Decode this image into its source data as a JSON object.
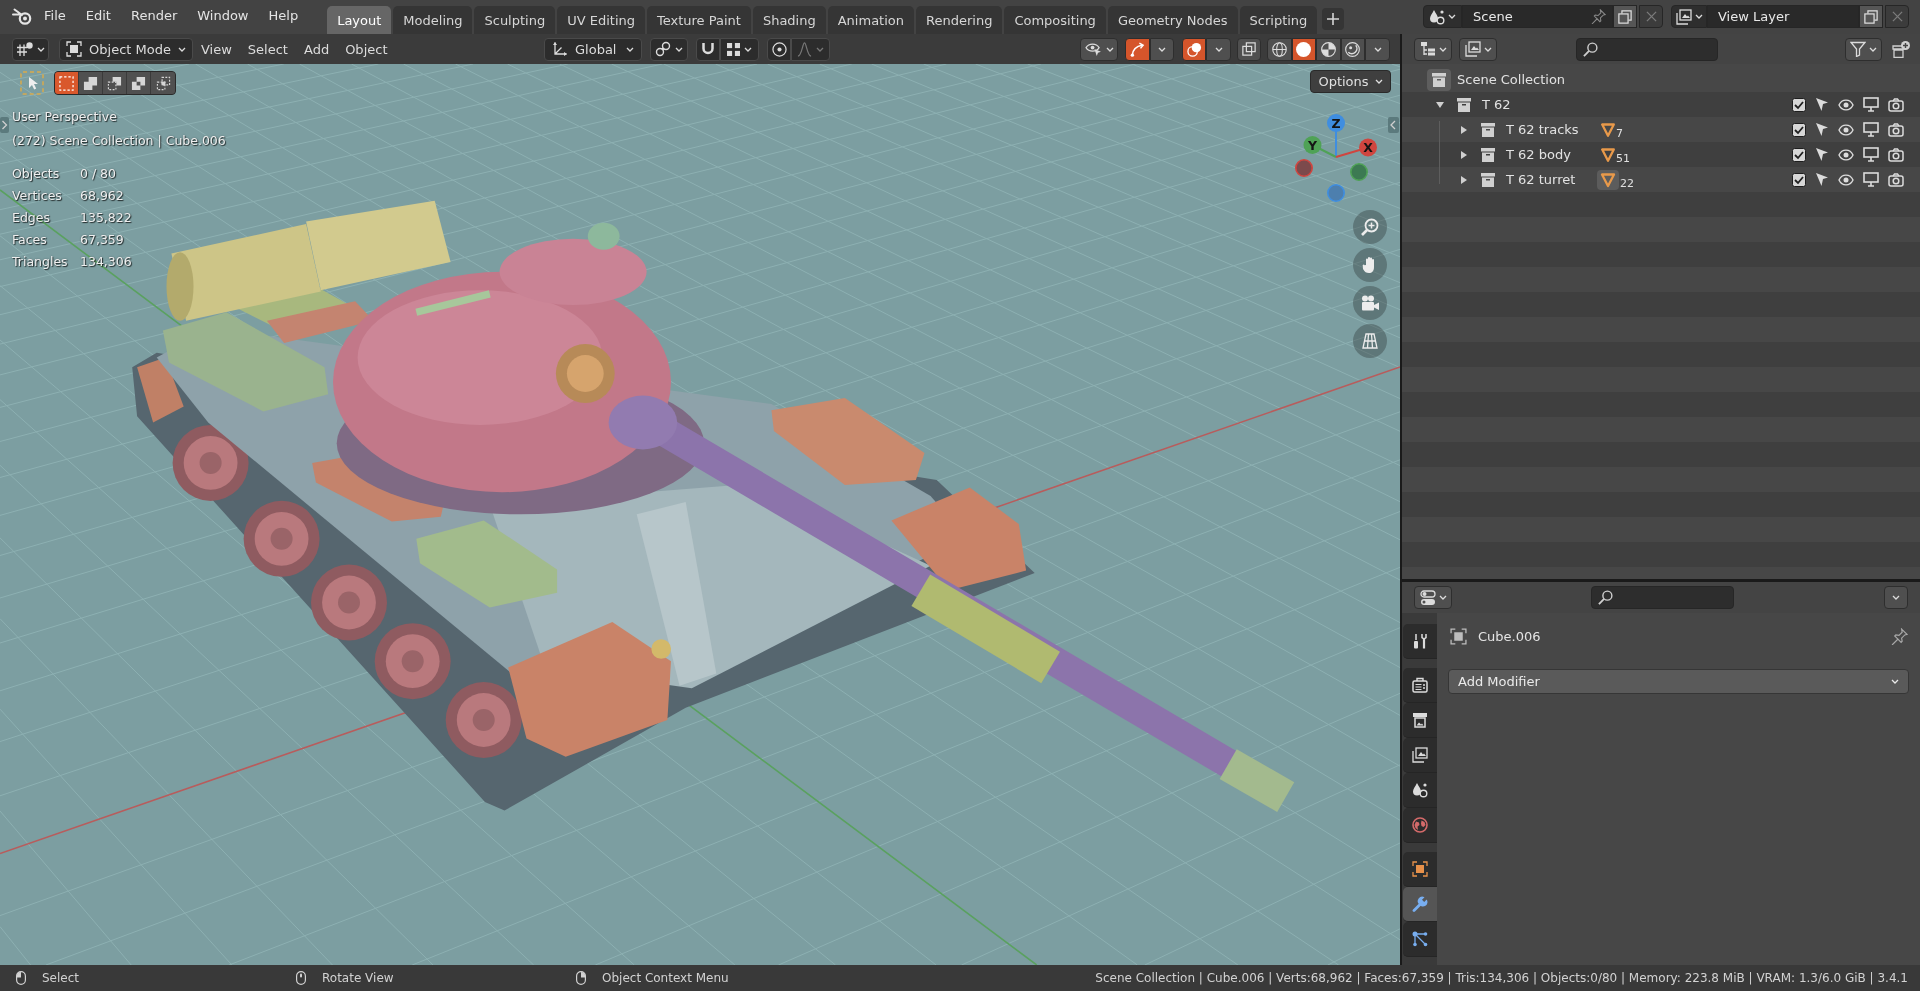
{
  "top_bar": {
    "menus": [
      "File",
      "Edit",
      "Render",
      "Window",
      "Help"
    ],
    "workspaces": [
      {
        "label": "Layout",
        "selected": true
      },
      {
        "label": "Modeling",
        "selected": false
      },
      {
        "label": "Sculpting",
        "selected": false
      },
      {
        "label": "UV Editing",
        "selected": false
      },
      {
        "label": "Texture Paint",
        "selected": false
      },
      {
        "label": "Shading",
        "selected": false
      },
      {
        "label": "Animation",
        "selected": false
      },
      {
        "label": "Rendering",
        "selected": false
      },
      {
        "label": "Compositing",
        "selected": false
      },
      {
        "label": "Geometry Nodes",
        "selected": false
      },
      {
        "label": "Scripting",
        "selected": false
      }
    ],
    "scene": "Scene",
    "view_layer": "View Layer"
  },
  "viewport": {
    "header": {
      "mode": "Object Mode",
      "menus": [
        "View",
        "Select",
        "Add",
        "Object"
      ],
      "orientation": "Global",
      "snap": false,
      "proportional_editing": false,
      "gizmos": true,
      "overlays": true,
      "xray": false,
      "shading": [
        {
          "kind": "wireframe",
          "selected": false
        },
        {
          "kind": "solid",
          "selected": true
        },
        {
          "kind": "material",
          "selected": false
        },
        {
          "kind": "rendered",
          "selected": false
        }
      ]
    },
    "select_modes": [
      {
        "kind": "set",
        "selected": true
      },
      {
        "kind": "extend",
        "selected": false
      },
      {
        "kind": "subtract",
        "selected": false
      },
      {
        "kind": "invert",
        "selected": false
      },
      {
        "kind": "intersect",
        "selected": false
      }
    ],
    "view_name": "User Perspective",
    "context": "(272) Scene Collection | Cube.006",
    "stats": [
      {
        "label": "Objects",
        "value": "0 / 80"
      },
      {
        "label": "Vertices",
        "value": "68,962"
      },
      {
        "label": "Edges",
        "value": "135,822"
      },
      {
        "label": "Faces",
        "value": "67,359"
      },
      {
        "label": "Triangles",
        "value": "134,306"
      }
    ],
    "options": "Options",
    "axes": [
      "Z",
      "Y",
      "X"
    ]
  },
  "outliner": {
    "root": "Scene Collection",
    "collections": [
      {
        "name": "T 62",
        "expanded": true,
        "checked": true,
        "children": [
          {
            "name": "T 62 tracks",
            "expanded": false,
            "checked": true,
            "count": "7",
            "active": false
          },
          {
            "name": "T 62 body",
            "expanded": false,
            "checked": true,
            "count": "51",
            "active": false
          },
          {
            "name": "T 62 turret",
            "expanded": false,
            "checked": true,
            "count": "22",
            "active": true
          }
        ]
      }
    ]
  },
  "properties": {
    "tabs": [
      {
        "kind": "tool",
        "selected": false
      },
      {
        "kind": "render",
        "selected": false
      },
      {
        "kind": "output",
        "selected": false
      },
      {
        "kind": "view_layer",
        "selected": false
      },
      {
        "kind": "scene",
        "selected": false
      },
      {
        "kind": "world",
        "selected": false
      },
      {
        "kind": "object",
        "selected": false
      },
      {
        "kind": "modifiers",
        "selected": true
      },
      {
        "kind": "particles",
        "selected": false
      }
    ],
    "object_name": "Cube.006",
    "add_modifier": "Add Modifier"
  },
  "status_bar": {
    "hints": [
      {
        "kind": "left_click",
        "label": "Select"
      },
      {
        "kind": "middle_click",
        "label": "Rotate View"
      },
      {
        "kind": "right_click",
        "label": "Object Context Menu"
      }
    ],
    "info": "Scene Collection | Cube.006 | Verts:68,962 | Faces:67,359 | Tris:134,306 | Objects:0/80 | Memory: 223.8 MiB | VRAM: 1.3/6.0 GiB | 3.4.1"
  }
}
